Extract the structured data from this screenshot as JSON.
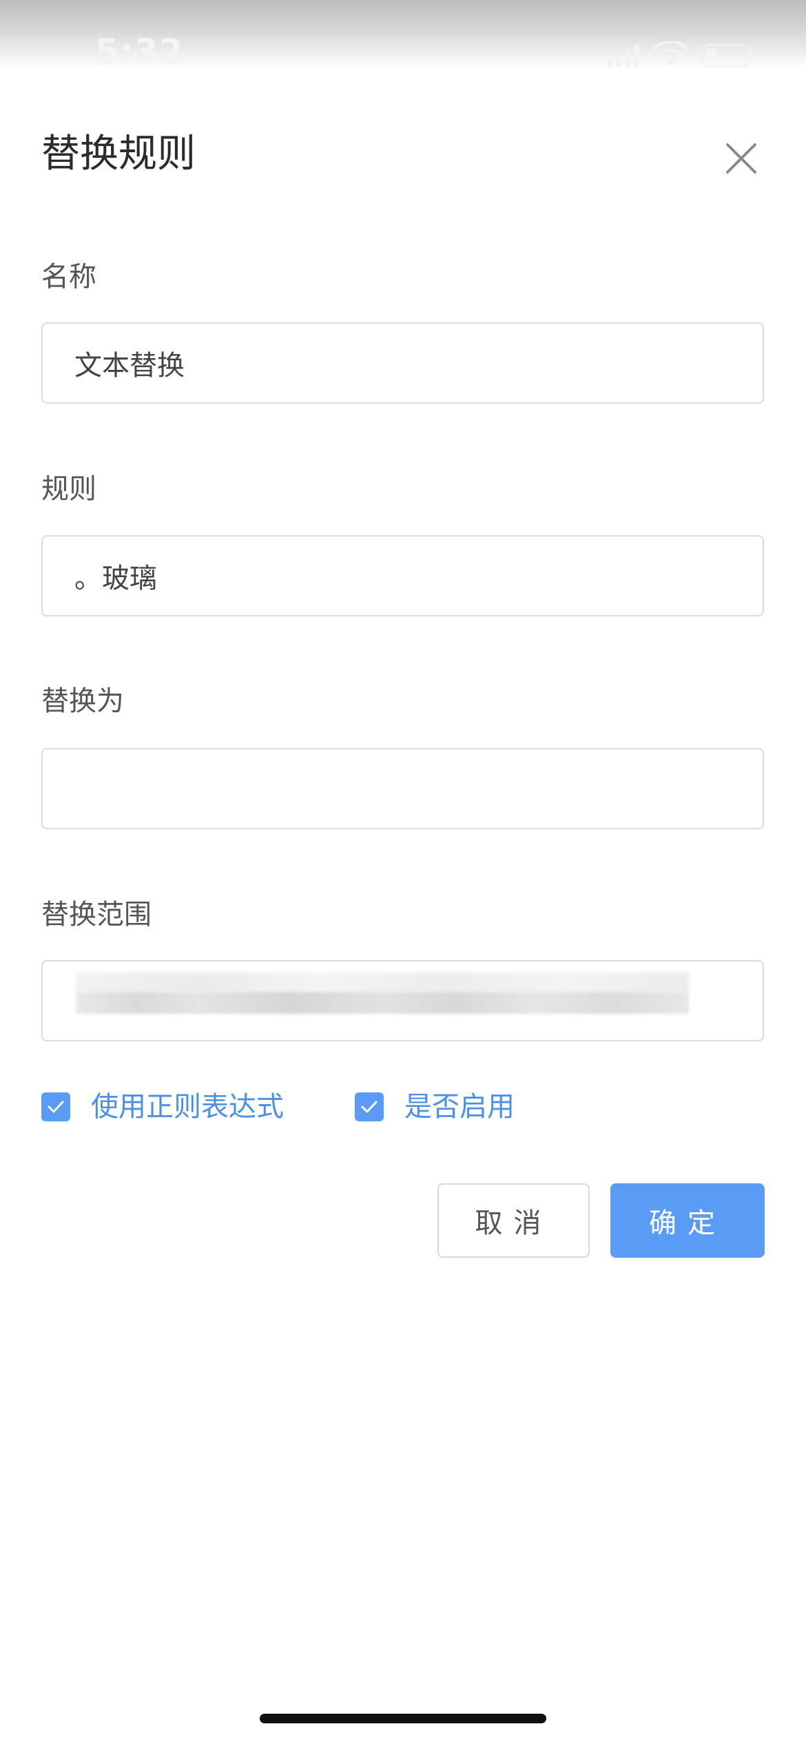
{
  "status_bar": {
    "time": "5:32"
  },
  "dialog": {
    "title": "替换规则",
    "fields": {
      "name": {
        "label": "名称",
        "value": "文本替换"
      },
      "rule": {
        "label": "规则",
        "value": "。玻璃"
      },
      "replace_with": {
        "label": "替换为",
        "value": ""
      },
      "scope": {
        "label": "替换范围"
      }
    },
    "checkboxes": {
      "use_regex": {
        "label": "使用正则表达式",
        "checked": true
      },
      "enabled": {
        "label": "是否启用",
        "checked": true
      }
    },
    "buttons": {
      "cancel": "取消",
      "ok": "确定"
    }
  },
  "colors": {
    "accent": "#5a9cf5",
    "accent_text": "#4a90e8",
    "border": "#dcdcdc"
  }
}
